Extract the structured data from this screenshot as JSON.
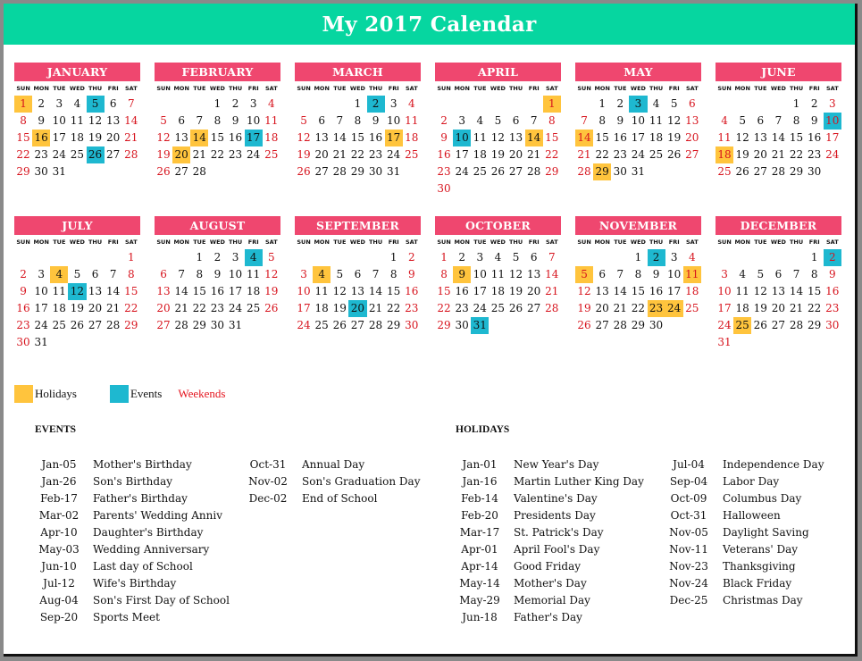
{
  "title": "My 2017 Calendar",
  "colors": {
    "banner": "#06d6a0",
    "month_header": "#ef476f",
    "holiday": "#ffc43d",
    "event": "#1eb8d0",
    "weekend_text": "#d7141e"
  },
  "weekday_labels": [
    "SUN",
    "MON",
    "TUE",
    "WED",
    "THU",
    "FRI",
    "SAT"
  ],
  "months": [
    {
      "name": "JANUARY",
      "start": 0,
      "days": 31,
      "holidays": [
        1,
        16
      ],
      "events": [
        5,
        26
      ]
    },
    {
      "name": "FEBRUARY",
      "start": 3,
      "days": 28,
      "holidays": [
        14,
        20
      ],
      "events": [
        17
      ]
    },
    {
      "name": "MARCH",
      "start": 3,
      "days": 31,
      "holidays": [
        17
      ],
      "events": [
        2
      ]
    },
    {
      "name": "APRIL",
      "start": 6,
      "days": 30,
      "holidays": [
        1,
        14
      ],
      "events": [
        10
      ]
    },
    {
      "name": "MAY",
      "start": 1,
      "days": 31,
      "holidays": [
        14,
        29
      ],
      "events": [
        3
      ]
    },
    {
      "name": "JUNE",
      "start": 4,
      "days": 30,
      "holidays": [
        18
      ],
      "events": [
        10
      ]
    },
    {
      "name": "JULY",
      "start": 6,
      "days": 31,
      "holidays": [
        4
      ],
      "events": [
        12
      ]
    },
    {
      "name": "AUGUST",
      "start": 2,
      "days": 31,
      "holidays": [],
      "events": [
        4
      ]
    },
    {
      "name": "SEPTEMBER",
      "start": 5,
      "days": 30,
      "holidays": [
        4
      ],
      "events": [
        20
      ]
    },
    {
      "name": "OCTOBER",
      "start": 0,
      "days": 31,
      "holidays": [
        9
      ],
      "events": [
        31
      ]
    },
    {
      "name": "NOVEMBER",
      "start": 3,
      "days": 30,
      "holidays": [
        5,
        11,
        23,
        24
      ],
      "events": [
        2
      ]
    },
    {
      "name": "DECEMBER",
      "start": 5,
      "days": 31,
      "holidays": [
        25
      ],
      "events": [
        2
      ]
    }
  ],
  "legend": {
    "holidays_label": "Holidays",
    "events_label": "Events",
    "weekends_label": "Weekends"
  },
  "events_section": {
    "title": "EVENTS",
    "items": [
      {
        "date": "Jan-05",
        "name": "Mother's Birthday"
      },
      {
        "date": "Jan-26",
        "name": "Son's Birthday"
      },
      {
        "date": "Feb-17",
        "name": "Father's Birthday"
      },
      {
        "date": "Mar-02",
        "name": "Parents' Wedding Anniv"
      },
      {
        "date": "Apr-10",
        "name": "Daughter's Birthday"
      },
      {
        "date": "May-03",
        "name": "Wedding Anniversary"
      },
      {
        "date": "Jun-10",
        "name": "Last day of School"
      },
      {
        "date": "Jul-12",
        "name": "Wife's Birthday"
      },
      {
        "date": "Aug-04",
        "name": "Son's First Day of School"
      },
      {
        "date": "Sep-20",
        "name": "Sports Meet"
      },
      {
        "date": "Oct-31",
        "name": "Annual Day"
      },
      {
        "date": "Nov-02",
        "name": "Son's Graduation Day"
      },
      {
        "date": "Dec-02",
        "name": "End of School"
      }
    ]
  },
  "holidays_section": {
    "title": "HOLIDAYS",
    "items": [
      {
        "date": "Jan-01",
        "name": "New Year's Day"
      },
      {
        "date": "Jan-16",
        "name": "Martin Luther King Day"
      },
      {
        "date": "Feb-14",
        "name": "Valentine's Day"
      },
      {
        "date": "Feb-20",
        "name": "Presidents Day"
      },
      {
        "date": "Mar-17",
        "name": "St. Patrick's Day"
      },
      {
        "date": "Apr-01",
        "name": "April Fool's Day"
      },
      {
        "date": "Apr-14",
        "name": "Good Friday"
      },
      {
        "date": "May-14",
        "name": "Mother's Day"
      },
      {
        "date": "May-29",
        "name": "Memorial Day"
      },
      {
        "date": "Jun-18",
        "name": "Father's Day"
      },
      {
        "date": "Jul-04",
        "name": "Independence Day"
      },
      {
        "date": "Sep-04",
        "name": "Labor Day"
      },
      {
        "date": "Oct-09",
        "name": "Columbus Day"
      },
      {
        "date": "Oct-31",
        "name": "Halloween"
      },
      {
        "date": "Nov-05",
        "name": "Daylight Saving"
      },
      {
        "date": "Nov-11",
        "name": "Veterans' Day"
      },
      {
        "date": "Nov-23",
        "name": "Thanksgiving"
      },
      {
        "date": "Nov-24",
        "name": "Black Friday"
      },
      {
        "date": "Dec-25",
        "name": "Christmas Day"
      }
    ]
  }
}
